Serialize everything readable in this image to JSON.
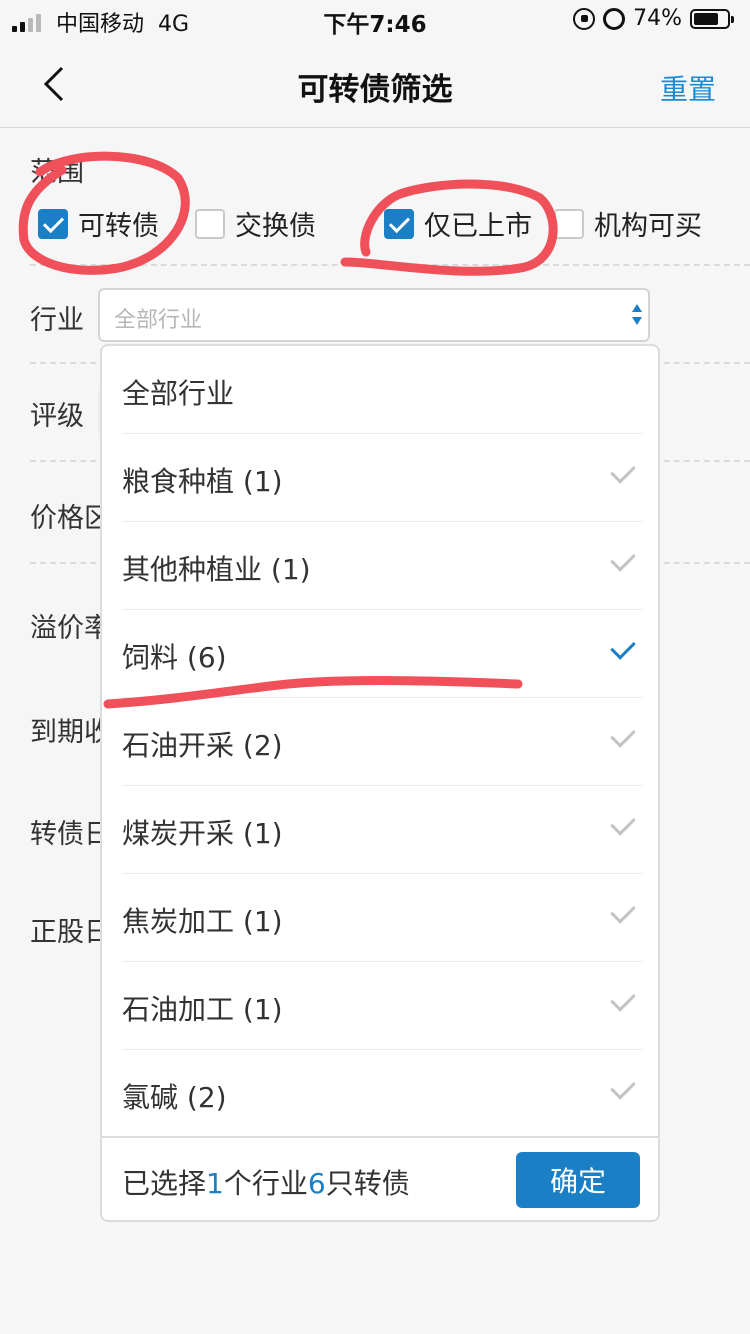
{
  "status_bar": {
    "carrier": "中国移动",
    "network": "4G",
    "time": "下午7:46",
    "battery": "74%",
    "battery_level": 0.74
  },
  "header": {
    "title": "可转债筛选",
    "reset_label": "重置",
    "back_icon": "chevron-left-icon"
  },
  "filters": {
    "range_label": "范围",
    "range_options": [
      {
        "label": "可转债",
        "checked": true
      },
      {
        "label": "交换债",
        "checked": false
      },
      {
        "label": "仅已上市",
        "checked": true
      },
      {
        "label": "机构可买",
        "checked": false
      }
    ],
    "industry_label": "行业",
    "industry_placeholder": "全部行业",
    "rating_label": "评级",
    "price_label": "价格区",
    "premium_label": "溢价率",
    "maturity_label": "到期收",
    "conversion_label": "转债日",
    "stock_label": "正股日"
  },
  "dropdown": {
    "options": [
      {
        "label": "全部行业",
        "check": "none"
      },
      {
        "label": "粮食种植 (1)",
        "check": "gray"
      },
      {
        "label": "其他种植业 (1)",
        "check": "gray"
      },
      {
        "label": "饲料 (6)",
        "check": "blue"
      },
      {
        "label": "石油开采 (2)",
        "check": "gray"
      },
      {
        "label": "煤炭开采 (1)",
        "check": "gray"
      },
      {
        "label": "焦炭加工 (1)",
        "check": "gray"
      },
      {
        "label": "石油加工 (1)",
        "check": "gray"
      },
      {
        "label": "氯碱 (2)",
        "check": "gray"
      }
    ],
    "summary_prefix": "已选择",
    "selected_industries": "1",
    "summary_mid": "个行业",
    "selected_bonds": "6",
    "summary_suffix": "只转债",
    "confirm_label": "确定"
  },
  "colors": {
    "accent": "#1a7fc4",
    "annotation": "#f0505a"
  }
}
